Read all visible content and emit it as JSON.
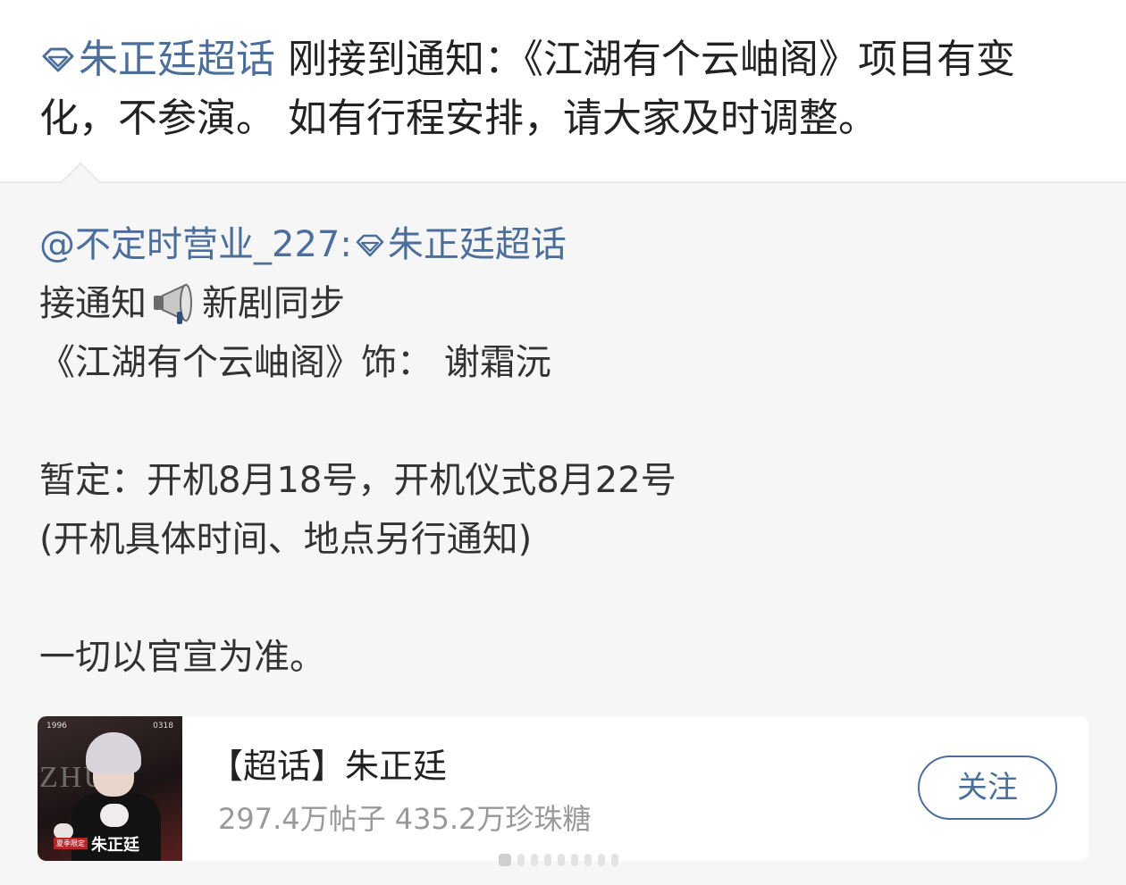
{
  "post": {
    "topic": "朱正廷超话",
    "text_line1": " 刚接到通知：《江湖有个云岫阁》项目有变",
    "text_line2": "化，不参演。 如有行程安排，请大家及时调整。"
  },
  "repost": {
    "author": "@不定时营业_227:",
    "topic": "朱正廷超话",
    "lines": {
      "l1_a": "接通知",
      "l1_b": "新剧同步",
      "l2": "《江湖有个云岫阁》饰：  谢霜沅",
      "l3": "暂定：开机8月18号，开机仪式8月22号",
      "l4": "(开机具体时间、地点另行通知)",
      "l5": "一切以官宣为准。"
    }
  },
  "card": {
    "title": "【超话】朱正廷",
    "stats": "297.4万帖子 435.2万珍珠糖",
    "follow_label": "关注",
    "thumb": {
      "num_left": "1996",
      "num_right": "0318",
      "letters": "ZHU",
      "name": "朱正廷",
      "tag": "夏季限定"
    }
  },
  "icons": {
    "topic_icon": "diamond-icon",
    "announce_icon": "megaphone-icon"
  },
  "colors": {
    "link": "#4b6e9a",
    "repost_background": "#f6f6f6",
    "muted_text": "#999999"
  }
}
